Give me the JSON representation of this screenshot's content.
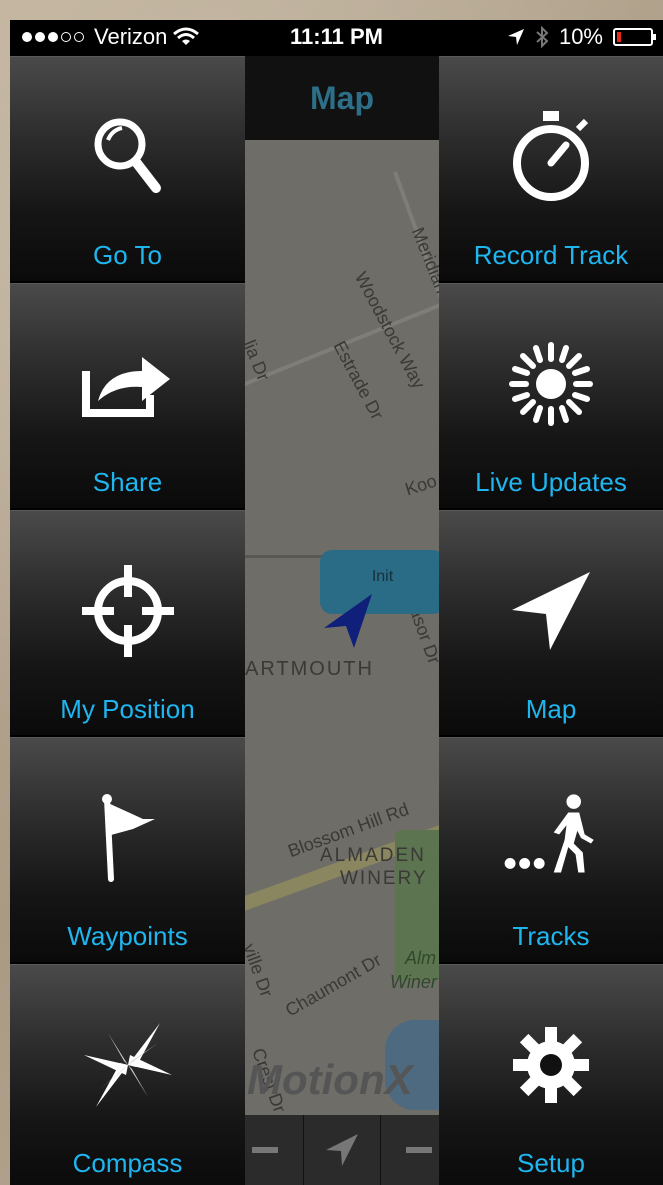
{
  "status_bar": {
    "carrier": "Verizon",
    "time": "11:11 PM",
    "battery": "10%"
  },
  "map": {
    "title": "Map",
    "labels": [
      "Meridian",
      "Woodstock Way",
      "Estrade Dr",
      "lia Dr",
      "Koo",
      "ARTMOUTH",
      "Blossom Hill Rd",
      "ALMADEN",
      "WINERY",
      "Alm",
      "Winer",
      "ville Dr",
      "Chaumont Dr",
      "Crest Dr",
      "asor Dr"
    ],
    "callout": "Init",
    "watermark": "MotionX"
  },
  "tiles_left": [
    {
      "label": "Go To",
      "icon": "magnifier-icon"
    },
    {
      "label": "Share",
      "icon": "share-icon"
    },
    {
      "label": "My Position",
      "icon": "crosshair-icon"
    },
    {
      "label": "Waypoints",
      "icon": "flag-icon"
    },
    {
      "label": "Compass",
      "icon": "compass-star-icon"
    }
  ],
  "tiles_right": [
    {
      "label": "Record Track",
      "icon": "stopwatch-icon"
    },
    {
      "label": "Live Updates",
      "icon": "broadcast-sun-icon"
    },
    {
      "label": "Map",
      "icon": "navigation-arrow-icon"
    },
    {
      "label": "Tracks",
      "icon": "walking-person-icon"
    },
    {
      "label": "Setup",
      "icon": "gear-icon"
    }
  ],
  "colors": {
    "label": "#1fb6f0",
    "map_title": "#2d6f88",
    "battery_low": "#e8281c"
  }
}
